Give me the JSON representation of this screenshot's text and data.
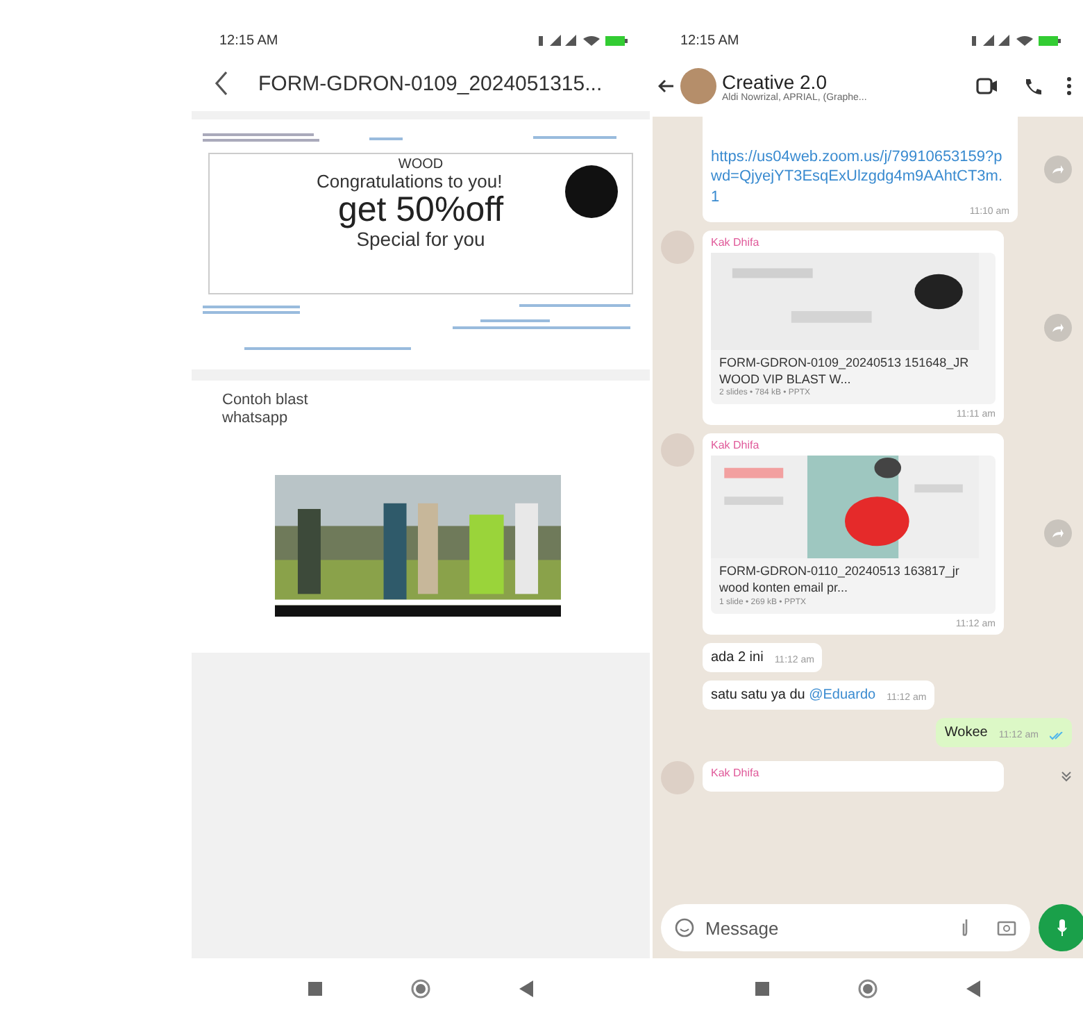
{
  "left_phone": {
    "status_time": "12:15 AM",
    "title": "FORM-GDRON-0109_2024051315...",
    "slide": {
      "brand": "WOOD",
      "headline": "Congratulations to you!",
      "offer": "get 50%off",
      "subline": "Special for you"
    },
    "slide_2": {
      "caption": [
        "Contoh blast",
        "whatsapp"
      ]
    }
  },
  "right_phone": {
    "status_time": "12:15 AM",
    "chat": {
      "name": "Creative 2.0",
      "members": "Aldi Nowrizal, APRIAL, (Graphe..."
    },
    "messages": [
      {
        "kind": "link",
        "outgoing": false,
        "text": "https://us04web.zoom.us/j/79910653159?pwd=QjyejYT3EsqExUlzgdg4m9AAhtCT3m.1",
        "time": "11:10 am"
      },
      {
        "kind": "document",
        "outgoing": false,
        "sender": "Kak Dhifa",
        "file": "FORM-GDRON-0109_20240513 151648_JR WOOD VIP BLAST W...",
        "meta": "2 slides • 784 kB • PPTX",
        "time": "11:11 am"
      },
      {
        "kind": "document",
        "outgoing": false,
        "sender": "Kak Dhifa",
        "file": "FORM-GDRON-0110_20240513 163817_jr wood konten email pr...",
        "meta": "1 slide • 269 kB • PPTX",
        "time": "11:12 am"
      },
      {
        "kind": "text",
        "outgoing": false,
        "text": "ada 2 ini",
        "time": "11:12 am"
      },
      {
        "kind": "text",
        "outgoing": false,
        "text": "satu satu ya du",
        "mention": "@Eduardo",
        "time": "11:12 am"
      },
      {
        "kind": "text",
        "outgoing": true,
        "text": "Wokee",
        "time": "11:12 am"
      },
      {
        "kind": "stub",
        "outgoing": false,
        "sender": "Kak Dhifa"
      }
    ],
    "composer": {
      "placeholder": "Message"
    }
  }
}
